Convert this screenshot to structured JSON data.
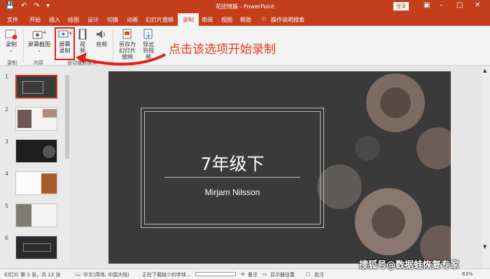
{
  "titlebar": {
    "title": "花团锦簇  -  PowerPoint",
    "login_label": "登录"
  },
  "tabs": [
    "文件",
    "开始",
    "插入",
    "绘图",
    "设计",
    "切换",
    "动画",
    "幻灯片放映",
    "录制",
    "审阅",
    "视图",
    "帮助",
    "操作说明搜索"
  ],
  "active_tab": "录制",
  "ribbon": {
    "record_label": "录制",
    "screenshot_label": "屏幕截图",
    "screen_record_label": "屏幕录制",
    "video_label": "视频",
    "audio_label": "音频",
    "save_as_show_label": "另存为幻灯片放映",
    "export_video_label": "导出到视频",
    "groups": {
      "record": "录制",
      "content": "内容",
      "auto_play": "自动播放媒体"
    }
  },
  "annotation": "点击该选项开始录制",
  "thumbnails": [
    "1",
    "2",
    "3",
    "4",
    "5",
    "6"
  ],
  "slide": {
    "title": "7年级下",
    "subtitle": "Mirjam Nilsson"
  },
  "statusbar": {
    "slide_info": "幻灯片 第 1 张，共 13 张",
    "language": "中文(简体, 中国大陆)",
    "progress_text": "正在下载缺少的字体...",
    "notes_label": "备注",
    "display_label": "显示器设置",
    "comments_label": "批注",
    "zoom": "63%"
  },
  "watermark": "搜狐号@数据蛙恢复专家"
}
